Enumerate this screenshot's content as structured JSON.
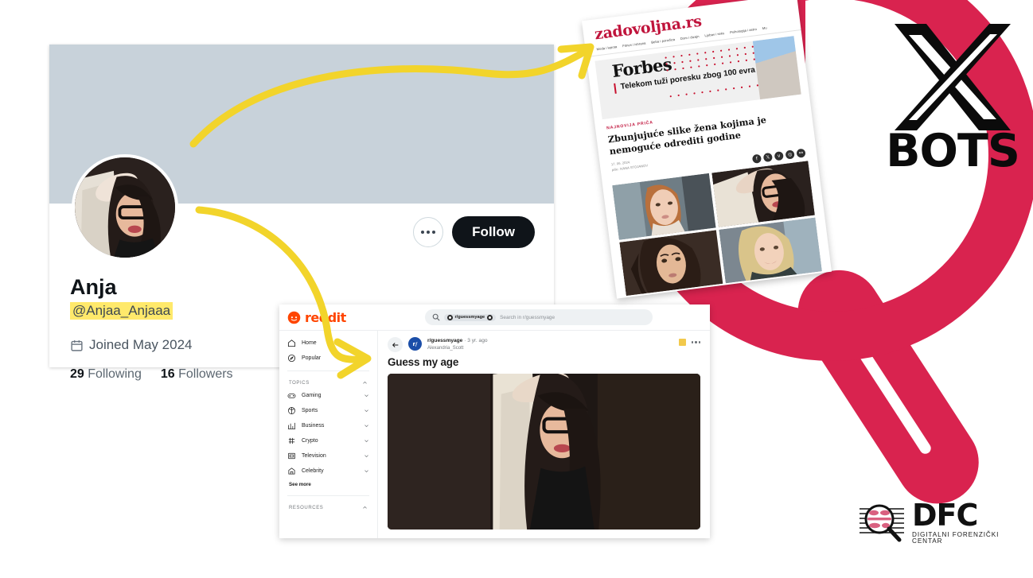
{
  "profile": {
    "name": "Anja",
    "handle": "@Anjaa_Anjaaa",
    "joined": "Joined May 2024",
    "following_count": "29",
    "following_label": "Following",
    "followers_count": "16",
    "followers_label": "Followers",
    "follow_button": "Follow",
    "banner_color": "#c8d2da",
    "handle_highlight_color": "#ffe96b"
  },
  "news": {
    "site_logo": "zadovoljna.rs",
    "nav": [
      "Moda i lepota",
      "Fitnes i ishrana",
      "Beba i porodica",
      "Dom i dizajn",
      "Ljubav i seks",
      "Psihologija i astro",
      "Mu"
    ],
    "ad": {
      "brand": "Forbes",
      "headline": "Telekom tuži poresku zbog 100 evra"
    },
    "kicker": "NAJNOVIJA PRIČA",
    "headline": "Zbunjujuće slike žena kojima je nemoguće odrediti godine",
    "date": "17. 06. 2024.",
    "author": "piše: IVANA STOJANOV",
    "social_icons": [
      "facebook-icon",
      "x-icon",
      "viber-icon",
      "instagram-icon",
      "link-icon"
    ],
    "photo_grid_count": 4
  },
  "reddit": {
    "brand": "reddit",
    "search": {
      "chip": "r/guessmyage",
      "placeholder": "Search in r/guessmyage"
    },
    "nav": [
      {
        "label": "Home",
        "icon": "home-icon"
      },
      {
        "label": "Popular",
        "icon": "popular-icon"
      }
    ],
    "topics_header": "TOPICS",
    "topics": [
      {
        "label": "Gaming",
        "icon": "gaming-icon"
      },
      {
        "label": "Sports",
        "icon": "sports-icon"
      },
      {
        "label": "Business",
        "icon": "business-icon"
      },
      {
        "label": "Crypto",
        "icon": "crypto-icon"
      },
      {
        "label": "Television",
        "icon": "television-icon"
      },
      {
        "label": "Celebrity",
        "icon": "celebrity-icon"
      }
    ],
    "see_more": "See more",
    "resources_header": "RESOURCES",
    "post": {
      "subreddit": "r/guessmyage",
      "age": "· 3 yr. ago",
      "author": "Alexandria_Scott",
      "title": "Guess my age",
      "avatar_letter": "r/"
    }
  },
  "branding": {
    "xbots_word": "BOTS",
    "xbots_mark": "x-logo",
    "dfc_word": "DFC",
    "dfc_tagline": "DIGITALNI FORENZIČKI CENTAR",
    "accent_pink": "#d9234f",
    "arrow_yellow": "#f2d42b"
  }
}
